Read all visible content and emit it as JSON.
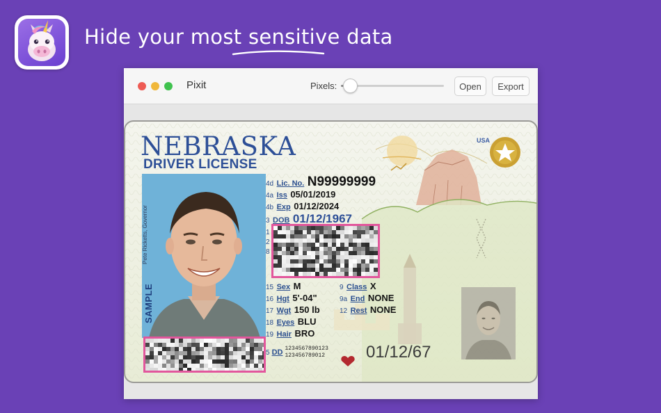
{
  "app": {
    "icon": "unicorn-app-icon"
  },
  "tagline": {
    "before": "Hide your most ",
    "emph": "sensitive",
    "after": " data"
  },
  "window": {
    "title": "Pixit",
    "pixels_label": "Pixels:",
    "pixel_level": 0.09,
    "open_label": "Open",
    "export_label": "Export",
    "colors": {
      "close": "#ee5b54",
      "minimize": "#f0b73a",
      "zoom": "#3fc24e"
    }
  },
  "license": {
    "state": "NEBRASKA",
    "type": "DRIVER LICENSE",
    "usa": "USA",
    "sample": "SAMPLE",
    "governor": "Pete Ricketts, Governor",
    "lic": {
      "num": "4d",
      "label": "Lic. No.",
      "value": "N99999999"
    },
    "iss": {
      "num": "4a",
      "label": "Iss",
      "value": "05/01/2019"
    },
    "exp": {
      "num": "4b",
      "label": "Exp",
      "value": "01/12/2024"
    },
    "dob": {
      "num": "3",
      "label": "DOB",
      "value": "01/12/1967"
    },
    "addr_nums": [
      "1",
      "2",
      "8"
    ],
    "sex": {
      "num": "15",
      "label": "Sex",
      "value": "M"
    },
    "hgt": {
      "num": "16",
      "label": "Hgt",
      "value": "5'-04\""
    },
    "wgt": {
      "num": "17",
      "label": "Wgt",
      "value": "150 lb"
    },
    "eyes": {
      "num": "18",
      "label": "Eyes",
      "value": "BLU"
    },
    "hair": {
      "num": "19",
      "label": "Hair",
      "value": "BRO"
    },
    "class": {
      "num": "9",
      "label": "Class",
      "value": "X"
    },
    "end": {
      "num": "9a",
      "label": "End",
      "value": "NONE"
    },
    "rest": {
      "num": "12",
      "label": "Rest",
      "value": "NONE"
    },
    "dd": {
      "num": "5",
      "label": "DD",
      "line1": "1234567890123",
      "line2": "123456789012"
    },
    "dob_short": "01/12/67"
  },
  "accent": {
    "redaction_border": "#e2569c",
    "brand_bg": "#6a41b6",
    "license_blue": "#2d4f97"
  }
}
